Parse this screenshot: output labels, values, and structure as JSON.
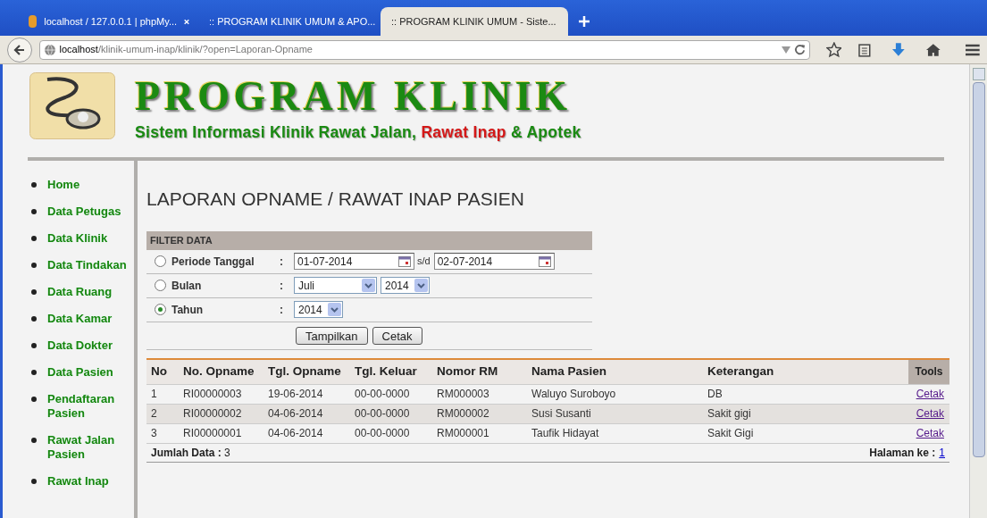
{
  "browser": {
    "tabs": [
      {
        "label": "localhost / 127.0.0.1 | phpMy...",
        "selected": false,
        "kind": "pma"
      },
      {
        "label": ":: PROGRAM KLINIK UMUM & APO...",
        "selected": false,
        "kind": "page"
      },
      {
        "label": ":: PROGRAM KLINIK UMUM - Siste...",
        "selected": true,
        "kind": "page"
      }
    ],
    "url_host": "localhost",
    "url_path": "/klinik-umum-inap/klinik/?open=Laporan-Opname"
  },
  "header": {
    "title": "PROGRAM KLINIK",
    "subtitle": [
      {
        "text": "Sistem Informasi Klinik Rawat Jalan, ",
        "highlight": false
      },
      {
        "text": "Rawat Inap",
        "highlight": true
      },
      {
        "text": " & Apotek",
        "highlight": false
      }
    ]
  },
  "sidebar": {
    "items": [
      "Home",
      "Data Petugas",
      "Data Klinik",
      "Data Tindakan",
      "Data Ruang",
      "Data Kamar",
      "Data Dokter",
      "Data Pasien",
      "Pendaftaran Pasien",
      "Rawat Jalan Pasien",
      "Rawat Inap"
    ]
  },
  "page_title": "LAPORAN OPNAME / RAWAT INAP PASIEN",
  "filter": {
    "title": "FILTER DATA",
    "rows": [
      {
        "label": "Periode Tanggal",
        "selected": false,
        "kind": "dates",
        "from": "01-07-2014",
        "sep": "s/d",
        "to": "02-07-2014"
      },
      {
        "label": "Bulan",
        "selected": false,
        "kind": "month",
        "month": "Juli",
        "year": "2014"
      },
      {
        "label": "Tahun",
        "selected": true,
        "kind": "year",
        "year": "2014"
      }
    ],
    "colon": ":",
    "buttons": [
      "Tampilkan",
      "Cetak"
    ]
  },
  "table": {
    "columns": [
      "No",
      "No. Opname",
      "Tgl. Opname",
      "Tgl. Keluar",
      "Nomor RM",
      "Nama Pasien",
      "Keterangan",
      "Tools"
    ],
    "rows": [
      [
        "1",
        "RI00000003",
        "19-06-2014",
        "00-00-0000",
        "RM000003",
        "Waluyo Suroboyo",
        "DB",
        "Cetak"
      ],
      [
        "2",
        "RI00000002",
        "04-06-2014",
        "00-00-0000",
        "RM000002",
        "Susi Susanti",
        "Sakit gigi",
        "Cetak"
      ],
      [
        "3",
        "RI00000001",
        "04-06-2014",
        "00-00-0000",
        "RM000001",
        "Taufik Hidayat",
        "Sakit Gigi",
        "Cetak"
      ]
    ],
    "total_label": "Jumlah Data :",
    "total": "3",
    "page_label": "Halaman ke :",
    "page": "1"
  }
}
